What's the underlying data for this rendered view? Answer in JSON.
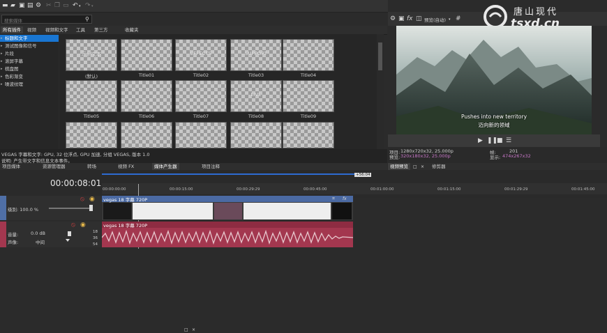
{
  "search": {
    "placeholder": "搜索媒体"
  },
  "tabs": [
    "所有插件",
    "视频",
    "视频和文字",
    "工具",
    "第三方",
    "收藏夹"
  ],
  "categories": [
    {
      "label": "标题和文字",
      "selected": true
    },
    {
      "label": "测试图像和信号",
      "selected": false
    },
    {
      "label": "片段",
      "selected": false
    },
    {
      "label": "滚屏字幕",
      "selected": false
    },
    {
      "label": "棋盘图",
      "selected": false
    },
    {
      "label": "色彩渐变",
      "selected": false
    },
    {
      "label": "噪波纹理",
      "selected": false
    }
  ],
  "presets": [
    {
      "name": "(默认)",
      "overlay": "示例文本"
    },
    {
      "name": "Title01",
      "overlay": ""
    },
    {
      "name": "Title02",
      "overlay": "EFFECTS"
    },
    {
      "name": "Title03",
      "overlay": "SUPPORT"
    },
    {
      "name": "Title04",
      "overlay": ""
    },
    {
      "name": "Title05",
      "overlay": ""
    },
    {
      "name": "Title06",
      "overlay": ""
    },
    {
      "name": "Title07",
      "overlay": ""
    },
    {
      "name": "Title08",
      "overlay": "LIVE"
    },
    {
      "name": "Title09",
      "overlay": ""
    },
    {
      "name": "",
      "overlay": ""
    },
    {
      "name": "",
      "overlay": ""
    },
    {
      "name": "",
      "overlay": ""
    },
    {
      "name": "",
      "overlay": ""
    },
    {
      "name": "",
      "overlay": ""
    }
  ],
  "status_line1": "VEGAS 字幕和文字: GPU, 32 位浮点, GPU 加速, 分组 VEGAS, 版本 1.0",
  "status_line2": "说明: 产生带文字和信息文本事件。",
  "bottom_tabs": [
    "项目媒体",
    "资源管理器",
    "转场",
    "视频 FX",
    "媒体产生器",
    "项目注释"
  ],
  "preview": {
    "dropdown": "预览(自动)",
    "subtitle_en": "Pushes into new territory",
    "subtitle_zh": "迈向新的领域",
    "project_label": "项目:",
    "project_value": "1280x720x32, 25.000p",
    "preview_label": "预览:",
    "preview_value": "320x180x32, 25.000p",
    "display_label": "显示:",
    "display_value": "474x267x32",
    "frame_label": "帧:",
    "frame_value": "201"
  },
  "preview_tabs": [
    "视频预览",
    "修剪器"
  ],
  "watermark": {
    "cn": "唐山现代",
    "domain": "tsxd.cn"
  },
  "timecode": "00:00:08:01",
  "ruler_marker": "+56:04",
  "ruler_labels": [
    "00:00:00:00",
    "00:00:15:00",
    "00:00:29:29",
    "00:00:45:00",
    "00:01:00:00",
    "00:01:15:00",
    "00:01:29:29",
    "00:01:45:00"
  ],
  "video_track": {
    "label": "级别: 100.0 %",
    "clip_title": "vegas 18 字幕 720P"
  },
  "audio_track": {
    "volume_label": "音量:",
    "volume_value": "0.0 dB",
    "pan_label": "声像:",
    "pan_value": "中间",
    "clip_title": "vegas 18 字幕 720P",
    "meter": [
      "18",
      "36",
      "54"
    ]
  }
}
